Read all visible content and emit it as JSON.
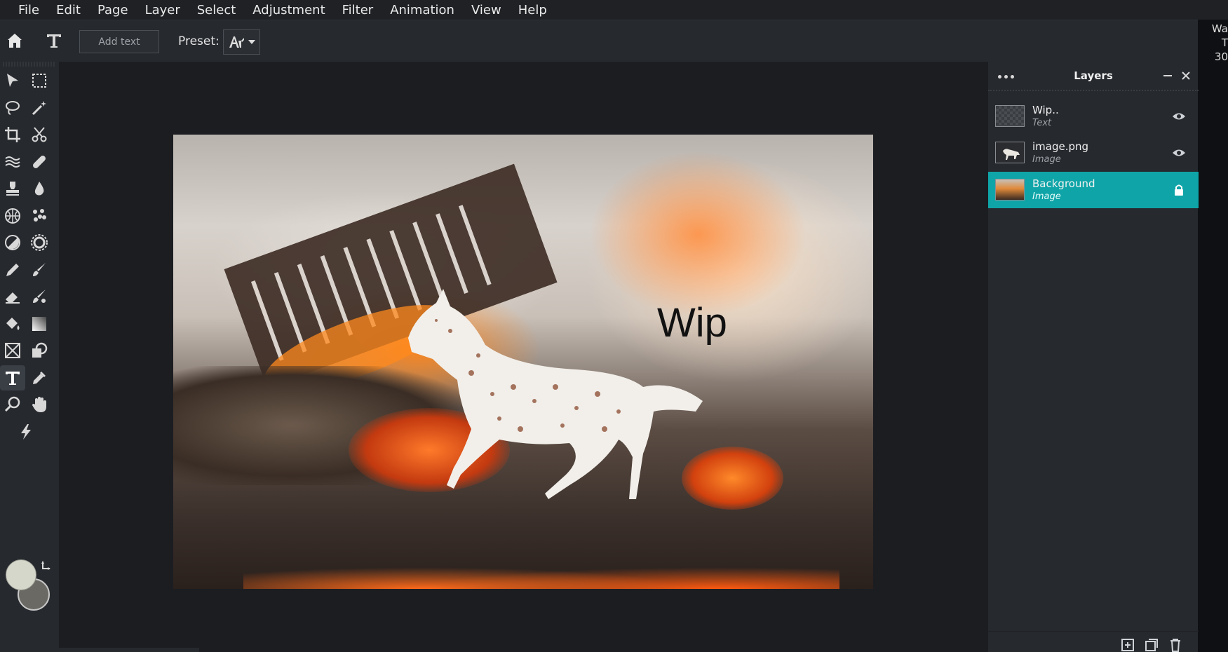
{
  "menu": [
    "File",
    "Edit",
    "Page",
    "Layer",
    "Select",
    "Adjustment",
    "Filter",
    "Animation",
    "View",
    "Help"
  ],
  "options": {
    "add_text_label": "Add text",
    "preset_label": "Preset:"
  },
  "tools": [
    {
      "icon": "move-arrow-icon"
    },
    {
      "icon": "marquee-select-icon"
    },
    {
      "icon": "lasso-icon"
    },
    {
      "icon": "magic-wand-icon"
    },
    {
      "icon": "crop-icon"
    },
    {
      "icon": "scissors-icon"
    },
    {
      "icon": "liquify-icon"
    },
    {
      "icon": "bandage-heal-icon"
    },
    {
      "icon": "clone-stamp-icon"
    },
    {
      "icon": "blur-drop-icon"
    },
    {
      "icon": "sponge-icon"
    },
    {
      "icon": "spot-heal-icon"
    },
    {
      "icon": "dodge-burn-icon"
    },
    {
      "icon": "sharpen-icon"
    },
    {
      "icon": "pencil-icon"
    },
    {
      "icon": "brush-icon"
    },
    {
      "icon": "eraser-icon"
    },
    {
      "icon": "color-replace-brush-icon"
    },
    {
      "icon": "paint-bucket-icon"
    },
    {
      "icon": "gradient-icon"
    },
    {
      "icon": "shape-frame-icon"
    },
    {
      "icon": "shape-icon"
    },
    {
      "icon": "text-tool-icon",
      "active": true
    },
    {
      "icon": "eyedropper-icon"
    },
    {
      "icon": "zoom-icon"
    },
    {
      "icon": "hand-icon"
    },
    {
      "icon": "quick-edit-bolt-icon"
    }
  ],
  "colors": {
    "primary": "#d5d7cb",
    "secondary": "#6a6964",
    "accent": "#0fa5a8"
  },
  "canvas": {
    "text": "Wip"
  },
  "sidestrip": [
    "Wa",
    "T",
    "30"
  ],
  "layers": {
    "title": "Layers",
    "items": [
      {
        "name": "Wip..",
        "type": "Text",
        "state_icon": "eye-icon"
      },
      {
        "name": "image.png",
        "type": "Image",
        "state_icon": "eye-icon"
      },
      {
        "name": "Background",
        "type": "Image",
        "state_icon": "lock-icon",
        "selected": true
      }
    ]
  }
}
